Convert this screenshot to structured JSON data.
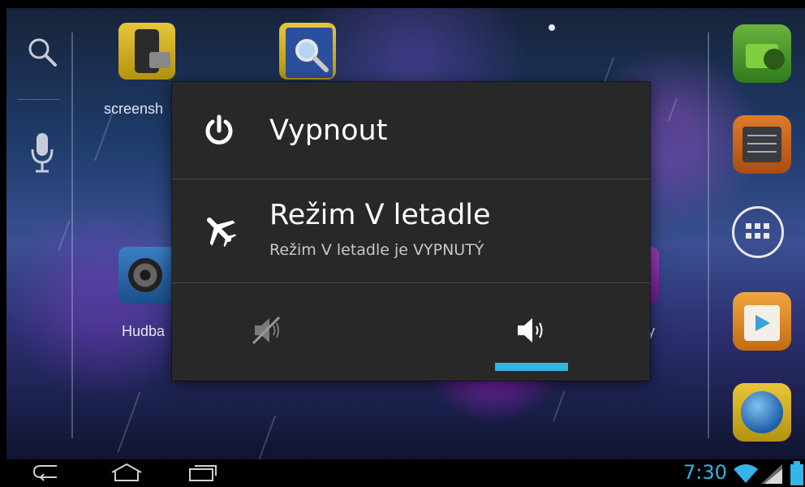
{
  "home": {
    "apps": [
      {
        "label": "screensh",
        "icon": "screenshot-app-icon"
      },
      {
        "label": "",
        "icon": "search-app-icon"
      },
      {
        "label": "Hudba",
        "icon": "music-app-icon"
      }
    ],
    "partial_label_right": "y",
    "dock": [
      "es-file-explorer-icon",
      "settings-icon",
      "all-apps-icon",
      "play-store-icon",
      "browser-icon"
    ]
  },
  "dialog": {
    "power_off": {
      "label": "Vypnout",
      "icon": "power-icon"
    },
    "airplane": {
      "label": "Režim V letadle",
      "status": "Režim V letadle je VYPNUTÝ",
      "icon": "airplane-icon"
    },
    "sound": {
      "silent": {
        "icon": "volume-muted-icon",
        "selected": false
      },
      "sound_on": {
        "icon": "volume-on-icon",
        "selected": true
      }
    },
    "accent_color": "#33b5e5"
  },
  "status_bar": {
    "time": "7:30",
    "icons": [
      "wifi-icon",
      "signal-icon",
      "battery-icon"
    ]
  },
  "navigation": [
    "back-icon",
    "home-icon",
    "recent-apps-icon"
  ]
}
